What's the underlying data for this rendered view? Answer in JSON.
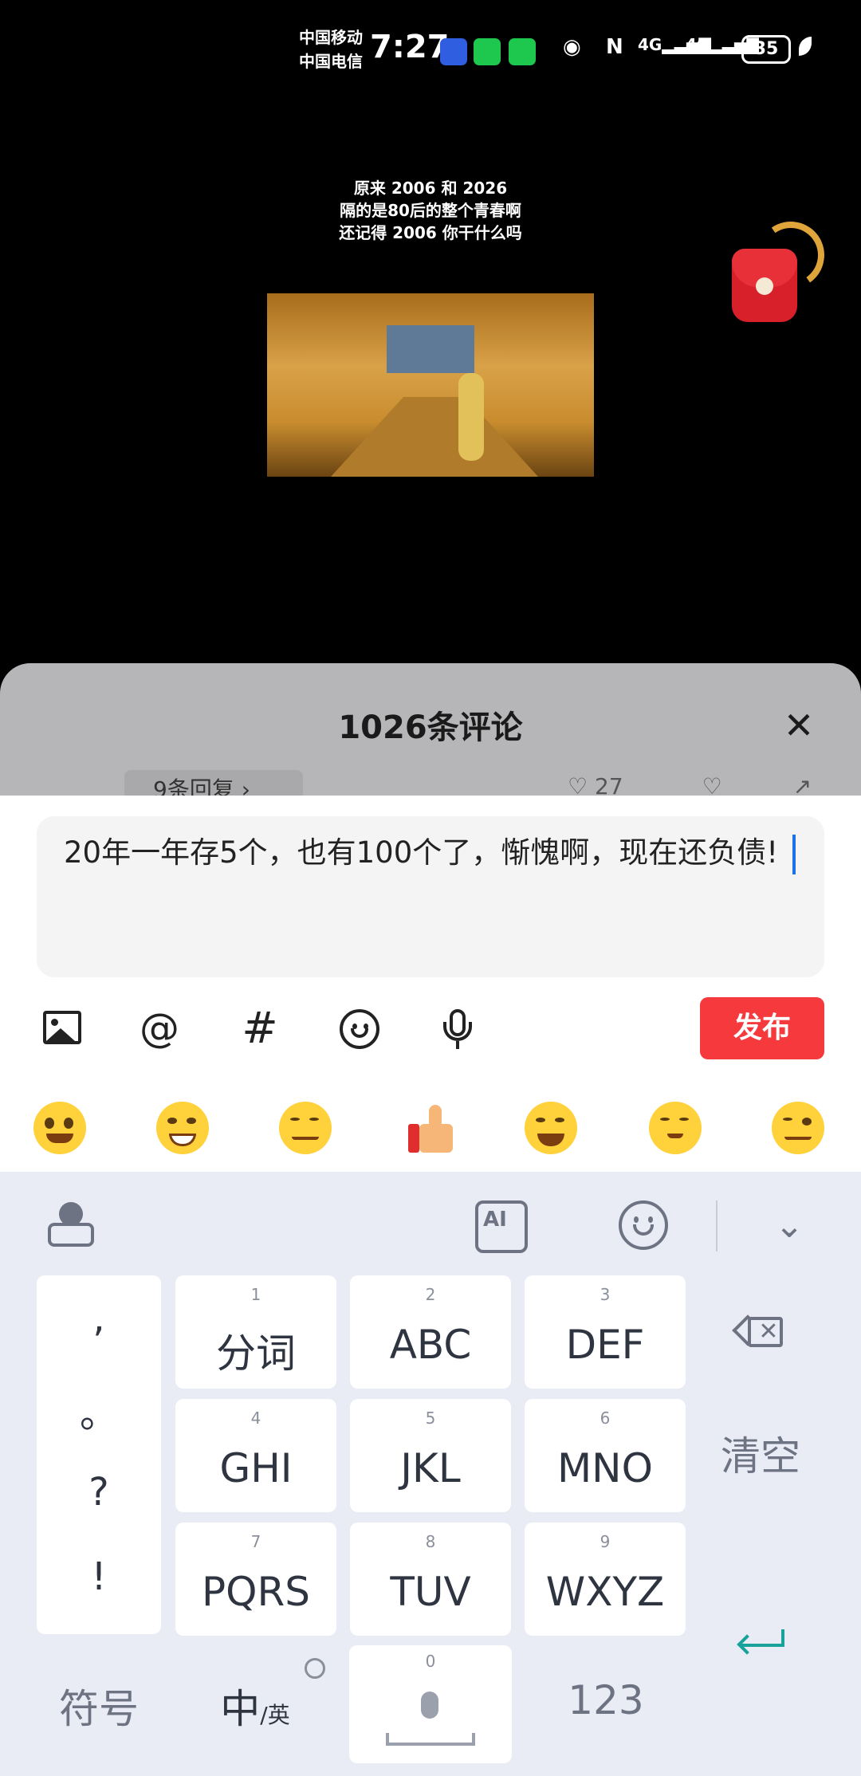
{
  "status_bar": {
    "carrier_1": "中国移动",
    "carrier_2": "中国电信",
    "time": "7:27",
    "network_1": "4G",
    "network_2": "4G",
    "battery": "35"
  },
  "video": {
    "caption_line_1": "原来 2006 和 2026",
    "caption_line_2": "隔的是80后的整个青春啊",
    "caption_line_3": "还记得 2006 你干什么吗"
  },
  "comments": {
    "title": "1026条评论",
    "replies_label": "9条回复 ›",
    "likes": "27"
  },
  "composer": {
    "text": "20年一年存5个，也有100个了，惭愧啊，现在还负债!",
    "publish_label": "发布"
  },
  "keyboard": {
    "ai_label": "AI",
    "punct": [
      ",",
      "。",
      "?",
      "!"
    ],
    "keys": [
      {
        "num": "1",
        "label": "分词"
      },
      {
        "num": "2",
        "label": "ABC"
      },
      {
        "num": "3",
        "label": "DEF"
      },
      {
        "num": "4",
        "label": "GHI"
      },
      {
        "num": "5",
        "label": "JKL"
      },
      {
        "num": "6",
        "label": "MNO"
      },
      {
        "num": "7",
        "label": "PQRS"
      },
      {
        "num": "8",
        "label": "TUV"
      },
      {
        "num": "9",
        "label": "WXYZ"
      }
    ],
    "clear_label": "清空",
    "symbol_label": "符号",
    "lang_main": "中",
    "lang_alt": "/英",
    "space_num": "0",
    "num_label": "123"
  },
  "colors": {
    "publish": "#f5393d",
    "caret": "#1a73e8",
    "enter": "#17a39a"
  }
}
